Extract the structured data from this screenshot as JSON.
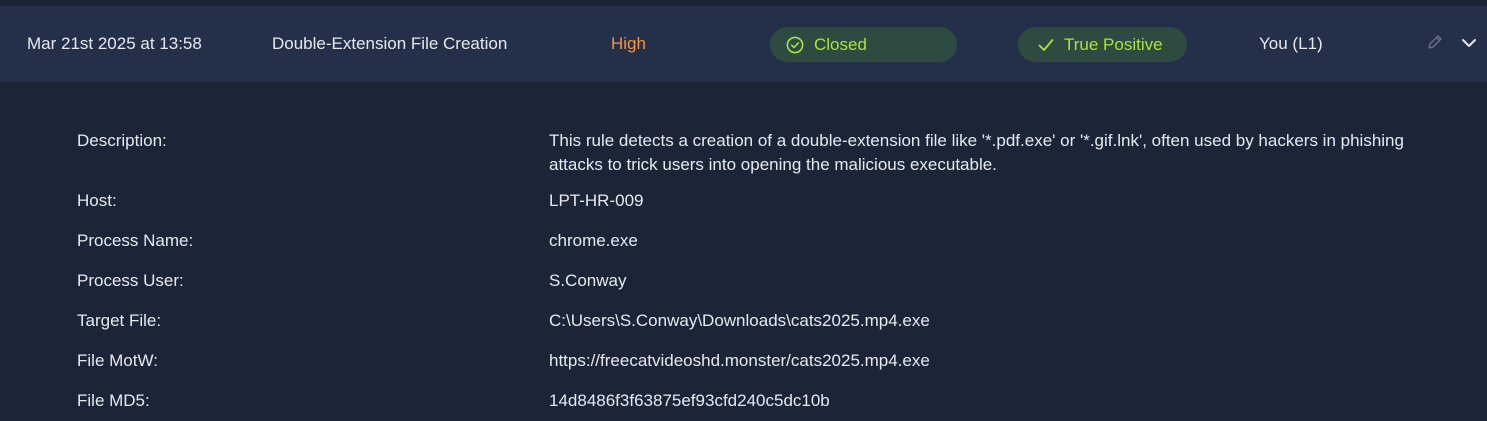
{
  "alert": {
    "date": "Mar 21st 2025 at 13:58",
    "rule": "Double-Extension File Creation",
    "severity": "High",
    "status": "Closed",
    "verdict": "True Positive",
    "assignee": "You (L1)"
  },
  "icons": {
    "status": "check-circle-icon",
    "verdict": "check-icon",
    "edit": "pencil-icon",
    "expand": "chevron-down-icon"
  },
  "colors": {
    "severity_high": "#f7943b",
    "status_green": "#a8e63b",
    "pill_bg": "#2f4a40",
    "row_bg": "#243049",
    "panel_bg": "#1c2438"
  },
  "details": {
    "description_label": "Description:",
    "description_value": "This rule detects a creation of a double-extension file like '*.pdf.exe' or '*.gif.lnk', often used by hackers in phishing attacks to trick users into opening the malicious executable.",
    "host_label": "Host:",
    "host_value": "LPT-HR-009",
    "process_name_label": "Process Name:",
    "process_name_value": "chrome.exe",
    "process_user_label": "Process User:",
    "process_user_value": "S.Conway",
    "target_file_label": "Target File:",
    "target_file_value": "C:\\Users\\S.Conway\\Downloads\\cats2025.mp4.exe",
    "file_motw_label": "File MotW:",
    "file_motw_value": "https://freecatvideoshd.monster/cats2025.mp4.exe",
    "file_md5_label": "File MD5:",
    "file_md5_value": "14d8486f3f63875ef93cfd240c5dc10b"
  }
}
